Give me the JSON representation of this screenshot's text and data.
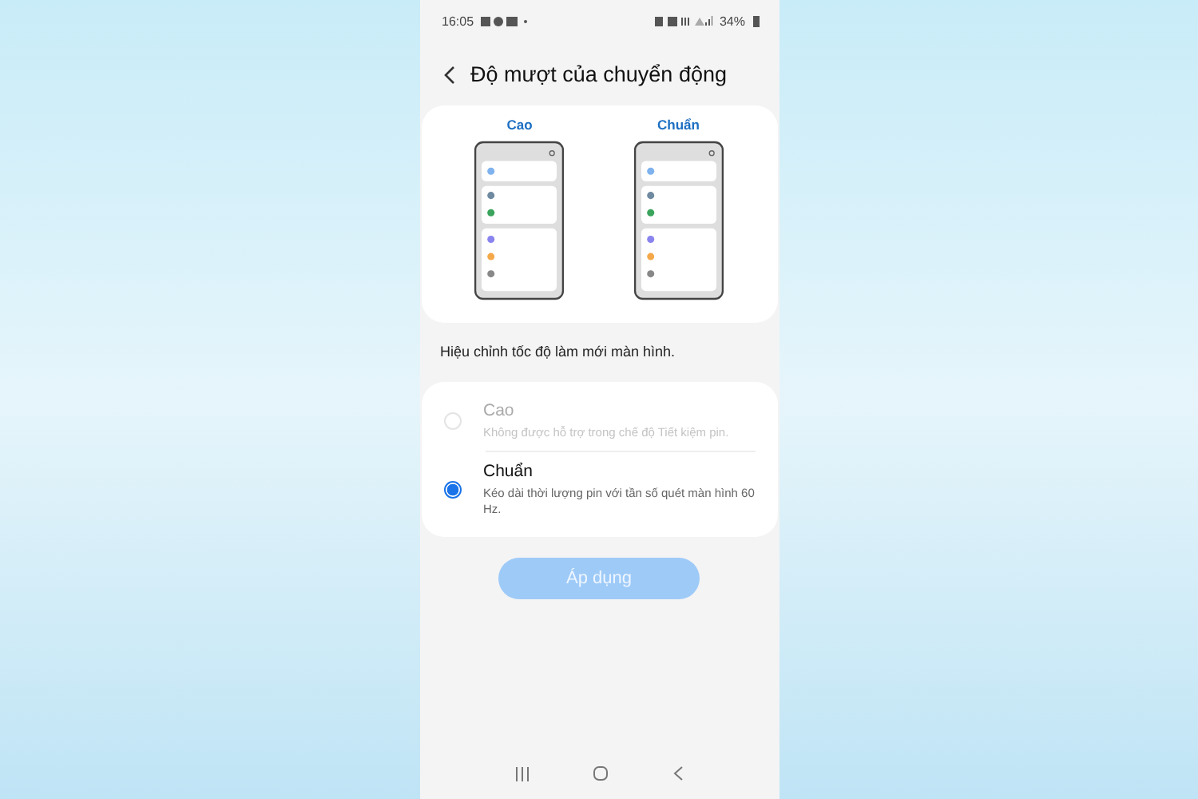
{
  "status_bar": {
    "time": "16:05",
    "battery": "34%"
  },
  "header": {
    "title": "Độ mượt của chuyển động"
  },
  "previews": [
    {
      "label": "Cao"
    },
    {
      "label": "Chuẩn"
    }
  ],
  "caption": "Hiệu chỉnh tốc độ làm mới màn hình.",
  "options": [
    {
      "title": "Cao",
      "description": "Không được hỗ trợ trong chế độ Tiết kiệm pin.",
      "selected": false,
      "disabled": true
    },
    {
      "title": "Chuẩn",
      "description": "Kéo dài thời lượng pin với tần số quét màn hình 60 Hz.",
      "selected": true,
      "disabled": false
    }
  ],
  "apply_button": {
    "label": "Áp dụng",
    "disabled": true
  }
}
